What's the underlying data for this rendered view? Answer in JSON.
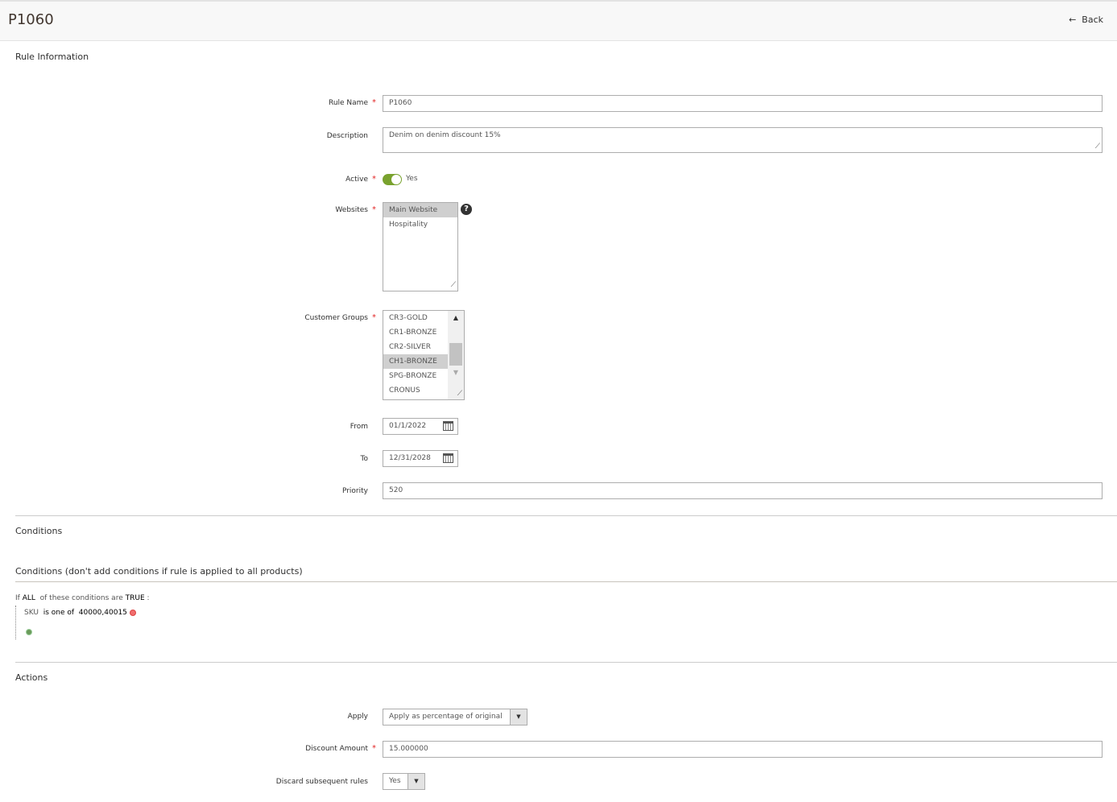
{
  "header": {
    "title": "P1060",
    "back_label": "Back"
  },
  "rule_info": {
    "section_title": "Rule Information",
    "rule_name": {
      "label": "Rule Name",
      "value": "P1060"
    },
    "description": {
      "label": "Description",
      "value": "Denim on denim discount 15%"
    },
    "active": {
      "label": "Active",
      "value": "Yes",
      "on": true
    },
    "websites": {
      "label": "Websites",
      "options": [
        "Main Website",
        "Hospitality"
      ],
      "selected": "Main Website"
    },
    "customer_groups": {
      "label": "Customer Groups",
      "options": [
        "CR3-GOLD",
        "CR1-BRONZE",
        "CR2-SILVER",
        "CH1-BRONZE",
        "SPG-BRONZE",
        "CRONUS"
      ],
      "selected": "CH1-BRONZE"
    },
    "from": {
      "label": "From",
      "value": "01/1/2022"
    },
    "to": {
      "label": "To",
      "value": "12/31/2028"
    },
    "priority": {
      "label": "Priority",
      "value": "520"
    }
  },
  "conditions": {
    "section_title": "Conditions",
    "subtitle": "Conditions (don't add conditions if rule is applied to all products)",
    "if": "If",
    "all": "ALL",
    "middle": "of these conditions are",
    "true": "TRUE",
    ":": ":",
    "colon": ":",
    "cond": {
      "attr": "SKU",
      "op": "is one of",
      "value": "40000,40015"
    }
  },
  "actions": {
    "section_title": "Actions",
    "apply": {
      "label": "Apply",
      "value": "Apply as percentage of original"
    },
    "discount": {
      "label": "Discount Amount",
      "value": "15.000000"
    },
    "discard": {
      "label": "Discard subsequent rules",
      "value": "Yes"
    }
  },
  "colors": {
    "toggle_on": "#79a22e",
    "required": "#e22626"
  }
}
